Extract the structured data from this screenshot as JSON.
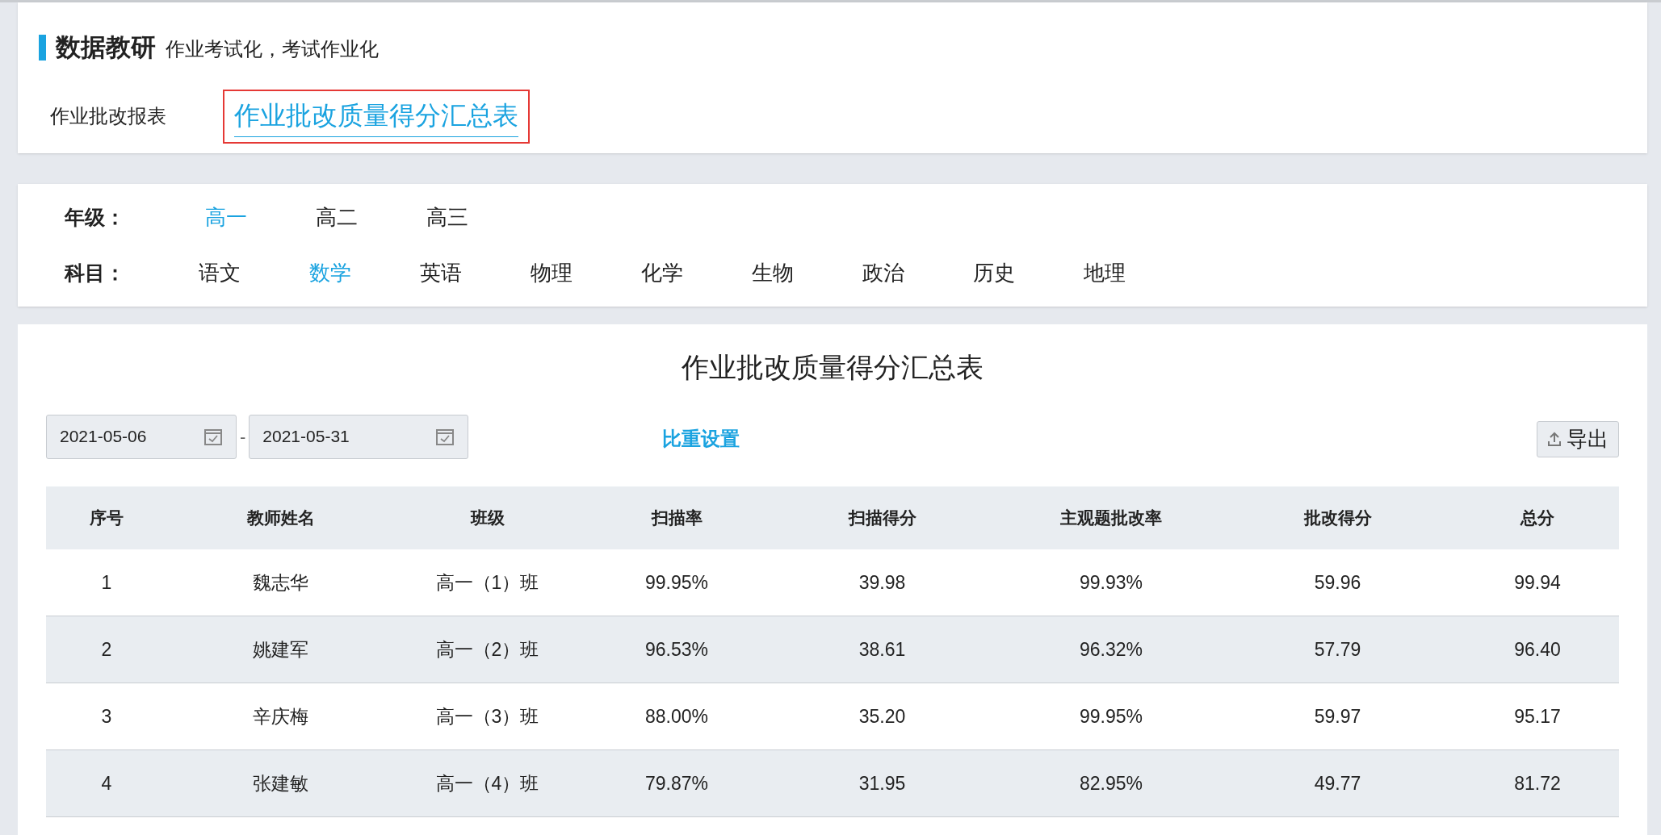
{
  "header": {
    "title": "数据教研",
    "subtitle": "作业考试化，考试作业化"
  },
  "tabs": [
    {
      "label": "作业批改报表",
      "selected": false,
      "outlined": false
    },
    {
      "label": "作业批改质量得分汇总表",
      "selected": true,
      "outlined": true
    }
  ],
  "filters": [
    {
      "label": "年级：",
      "options": [
        {
          "label": "高一",
          "selected": true
        },
        {
          "label": "高二",
          "selected": false
        },
        {
          "label": "高三",
          "selected": false
        }
      ]
    },
    {
      "label": "科目：",
      "options": [
        {
          "label": "语文",
          "selected": false
        },
        {
          "label": "数学",
          "selected": true
        },
        {
          "label": "英语",
          "selected": false
        },
        {
          "label": "物理",
          "selected": false
        },
        {
          "label": "化学",
          "selected": false
        },
        {
          "label": "生物",
          "selected": false
        },
        {
          "label": "政治",
          "selected": false
        },
        {
          "label": "历史",
          "selected": false
        },
        {
          "label": "地理",
          "selected": false
        }
      ]
    }
  ],
  "report": {
    "title": "作业批改质量得分汇总表",
    "start_date": "2021-05-06",
    "separator": "-",
    "end_date": "2021-05-31",
    "weight_link": "比重设置",
    "export_button": "导出",
    "table": {
      "columns": [
        "序号",
        "教师姓名",
        "班级",
        "扫描率",
        "扫描得分",
        "主观题批改率",
        "批改得分",
        "总分"
      ],
      "rows": [
        [
          "1",
          "魏志华",
          "高一（1）班",
          "99.95%",
          "39.98",
          "99.93%",
          "59.96",
          "99.94"
        ],
        [
          "2",
          "姚建军",
          "高一（2）班",
          "96.53%",
          "38.61",
          "96.32%",
          "57.79",
          "96.40"
        ],
        [
          "3",
          "辛庆梅",
          "高一（3）班",
          "88.00%",
          "35.20",
          "99.95%",
          "59.97",
          "95.17"
        ],
        [
          "4",
          "张建敏",
          "高一（4）班",
          "79.87%",
          "31.95",
          "82.95%",
          "49.77",
          "81.72"
        ]
      ]
    }
  }
}
